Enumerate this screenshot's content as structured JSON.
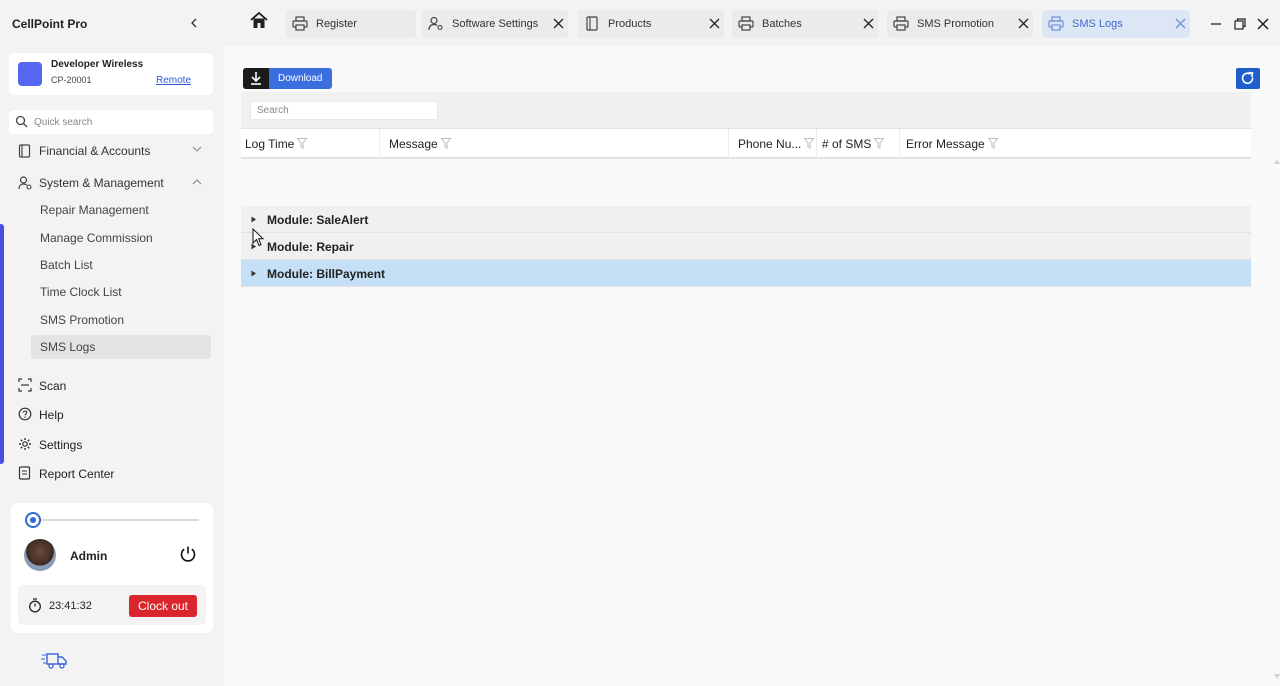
{
  "app": {
    "title": "CellPoint Pro"
  },
  "store": {
    "name": "Developer Wireless",
    "code": "CP-20001",
    "remote_label": "Remote",
    "logo_color": "#5566f0"
  },
  "quick_search": {
    "placeholder": "Quick search"
  },
  "nav": {
    "financial": {
      "label": "Financial & Accounts",
      "icon": "book-icon"
    },
    "system": {
      "label": "System & Management",
      "icon": "user-gear-icon"
    },
    "system_items": [
      {
        "label": "Repair Management"
      },
      {
        "label": "Manage Commission"
      },
      {
        "label": "Batch List"
      },
      {
        "label": "Time Clock List"
      },
      {
        "label": "SMS Promotion"
      },
      {
        "label": "SMS Logs",
        "active": true
      }
    ],
    "scan": {
      "label": "Scan",
      "icon": "scan-icon"
    },
    "help": {
      "label": "Help",
      "icon": "help-icon"
    },
    "settings": {
      "label": "Settings",
      "icon": "gear-icon"
    },
    "report": {
      "label": "Report Center",
      "icon": "report-icon"
    }
  },
  "user": {
    "name": "Admin",
    "clock_time": "23:41:32",
    "clockout_label": "Clock out"
  },
  "tabs": [
    {
      "label": "Register",
      "icon": "printer-icon"
    },
    {
      "label": "Software Settings",
      "icon": "user-gear-icon"
    },
    {
      "label": "Products",
      "icon": "phone-icon"
    },
    {
      "label": "Batches",
      "icon": "printer-icon"
    },
    {
      "label": "SMS Promotion",
      "icon": "printer-icon"
    },
    {
      "label": "SMS Logs",
      "icon": "printer-icon",
      "active": true
    }
  ],
  "toolbar": {
    "download_label": "Download"
  },
  "grid": {
    "search_placeholder": "Search",
    "columns": [
      "Log Time",
      "Message",
      "Phone Nu...",
      "# of SMS",
      "Error Message"
    ],
    "groups": [
      {
        "label": "Module: SaleAlert"
      },
      {
        "label": "Module: Repair"
      },
      {
        "label": "Module: BillPayment",
        "selected": true
      }
    ]
  },
  "colors": {
    "accent": "#3b6fe0",
    "selected_row": "#c5dff7",
    "clockout": "#d9252b"
  }
}
